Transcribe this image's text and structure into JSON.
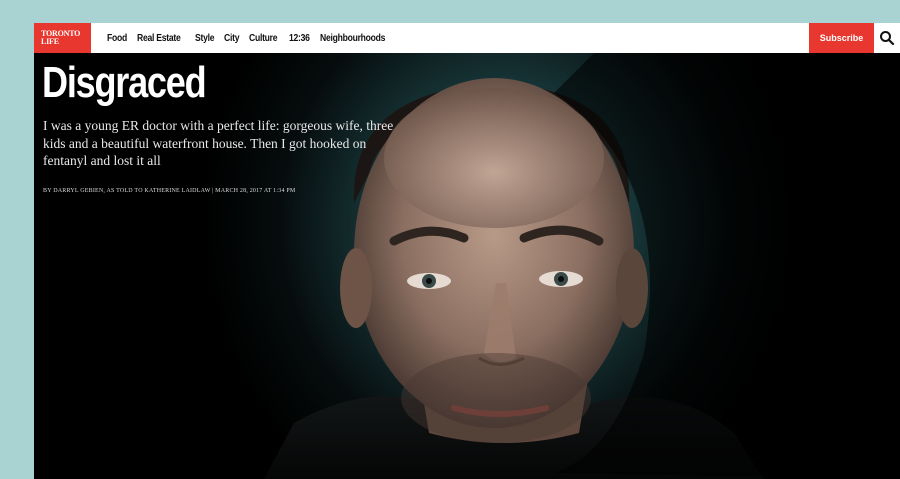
{
  "logo": {
    "line1": "TORONTO",
    "line2": "LIFE"
  },
  "nav": {
    "items": [
      {
        "label": "Food"
      },
      {
        "label": "Real Estate"
      },
      {
        "label": "Style"
      },
      {
        "label": "City"
      },
      {
        "label": "Culture"
      },
      {
        "label": "12:36"
      },
      {
        "label": "Neighbourhoods"
      }
    ],
    "subscribe_label": "Subscribe"
  },
  "article": {
    "headline": "Disgraced",
    "dek": "I was a young ER doctor with a perfect life: gorgeous wife, three kids and a beautiful waterfront house. Then I got hooked on fentanyl and lost it all",
    "byline": "By Darryl Gebien, as told to Katherine Laidlaw | March 28, 2017 at 1:34 PM"
  },
  "icons": {
    "search": "search-icon",
    "portrait": "portrait-photo"
  },
  "colors": {
    "frame_bg": "#a9d3d3",
    "brand_red": "#e8372f",
    "hero_bg": "#000000"
  }
}
